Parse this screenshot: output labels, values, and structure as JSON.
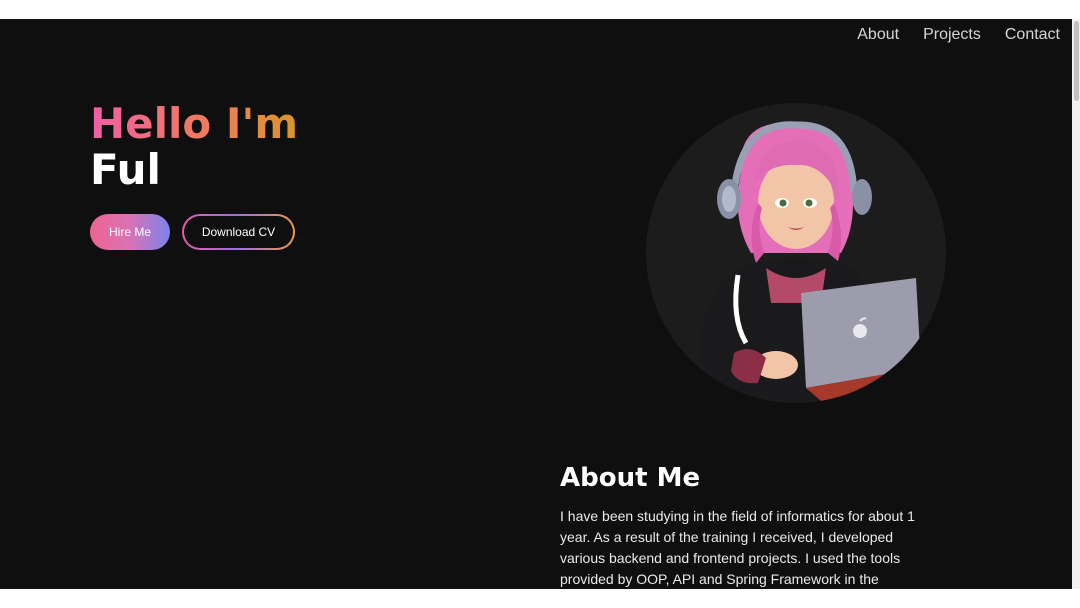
{
  "nav": {
    "items": [
      "About",
      "Projects",
      "Contact"
    ]
  },
  "hero": {
    "greeting": "Hello I'm",
    "name": "Ful",
    "hire_label": "Hire Me",
    "download_label": "Download CV"
  },
  "about": {
    "title": "About Me",
    "text": "I have been studying in the field of informatics for about 1 year. As a result of the training I received, I developed various backend and frontend projects. I used the tools provided by OOP, API and Spring Framework in the"
  },
  "colors": {
    "background": "#0f0f0f",
    "gradient_pink": "#ef5fa7",
    "gradient_orange": "#d8962a",
    "gradient_blue": "#7b83eb",
    "avatar_circle": "#1c1c1c"
  },
  "icons": [
    "avatar-illustration",
    "laptop-apple-logo"
  ]
}
